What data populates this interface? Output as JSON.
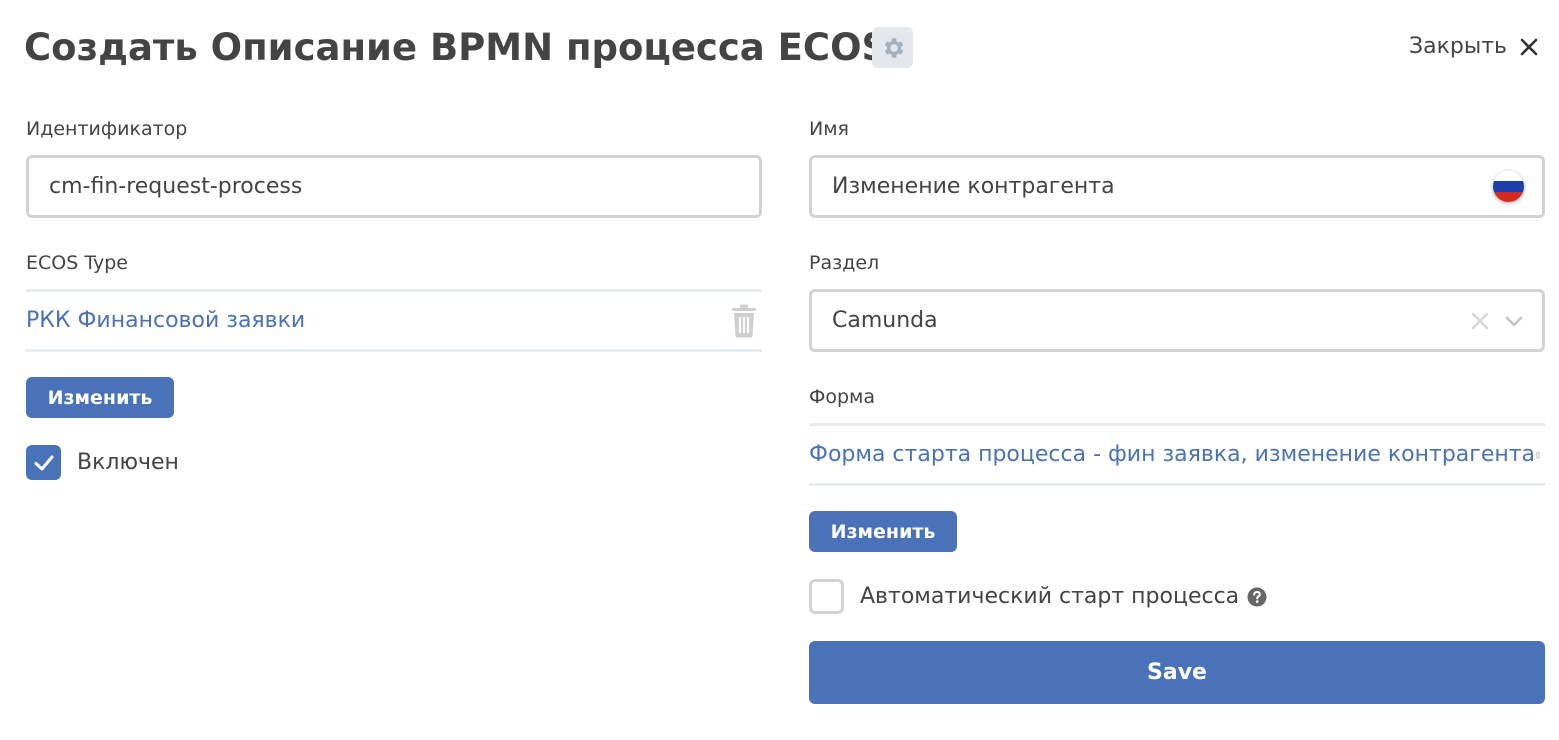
{
  "header": {
    "title": "Создать Описание BPMN процесса ECOS",
    "close_label": "Закрыть"
  },
  "left": {
    "id_label": "Идентификатор",
    "id_value": "cm-fin-request-process",
    "type_label": "ECOS Type",
    "type_value": "РКК Финансовой заявки",
    "change_label": "Изменить",
    "enabled_label": "Включен",
    "enabled_checked": true
  },
  "right": {
    "name_label": "Имя",
    "name_value": "Изменение контрагента",
    "section_label": "Раздел",
    "section_value": "Camunda",
    "form_label": "Форма",
    "form_value": "Форма старта процесса - фин заявка, изменение контрагента",
    "change_label": "Изменить",
    "autostart_label": "Автоматический старт процесса",
    "autostart_checked": false,
    "save_label": "Save"
  },
  "colors": {
    "primary": "#4a72b8",
    "link": "#4b72b5",
    "text": "#444444",
    "border": "#d3d3d3"
  },
  "icons": {
    "gear": "gear-icon",
    "close": "close-icon",
    "flag": "russian-flag-icon",
    "trash": "trash-icon",
    "check": "check-icon",
    "clear": "clear-icon",
    "chevron": "chevron-down-icon",
    "help": "question-circle-icon"
  }
}
